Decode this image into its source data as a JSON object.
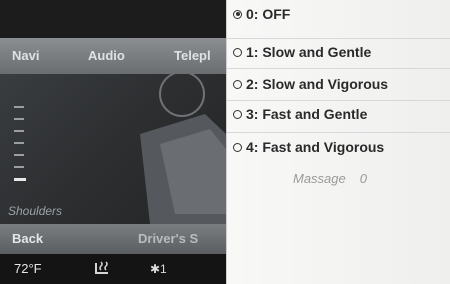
{
  "menubar": {
    "items": [
      "Navi",
      "Audio",
      "Telepl"
    ]
  },
  "seat_view": {
    "label": "Shoulders"
  },
  "bottom_bar": {
    "back_label": "Back",
    "title": "Driver's S"
  },
  "status_bar": {
    "temperature": "72°F",
    "fan": "✱1",
    "icon": "seat-heater-icon"
  },
  "massage_menu": {
    "options": [
      {
        "label": "0: OFF",
        "selected": true
      },
      {
        "label": "1: Slow and Gentle",
        "selected": false
      },
      {
        "label": "2: Slow and Vigorous",
        "selected": false
      },
      {
        "label": "3: Fast and Gentle",
        "selected": false
      },
      {
        "label": "4: Fast and Vigorous",
        "selected": false
      }
    ],
    "status_label": "Massage",
    "status_value": "0"
  },
  "colors": {
    "panel_bg": "#f3f3f2",
    "screen_bg": "#2a2b2c",
    "menubar": "#7d8083"
  }
}
